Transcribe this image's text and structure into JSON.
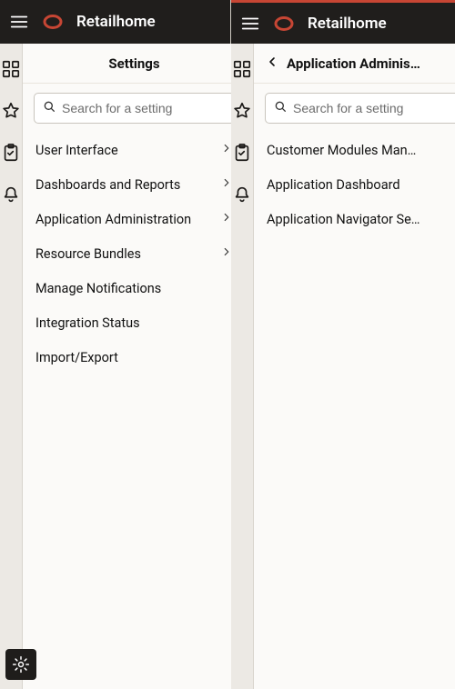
{
  "app_title": "Retailhome",
  "search_placeholder": "Search for a setting",
  "left": {
    "header": "Settings",
    "items": [
      {
        "label": "User Interface",
        "has_children": true
      },
      {
        "label": "Dashboards and Reports",
        "has_children": true
      },
      {
        "label": "Application Administration",
        "has_children": true
      },
      {
        "label": "Resource Bundles",
        "has_children": true
      },
      {
        "label": "Manage Notifications",
        "has_children": false
      },
      {
        "label": "Integration Status",
        "has_children": false
      },
      {
        "label": "Import/Export",
        "has_children": false
      }
    ]
  },
  "right": {
    "header": "Application Administra…",
    "items": [
      {
        "label": "Customer Modules Man…",
        "has_children": false
      },
      {
        "label": "Application Dashboard",
        "has_children": false
      },
      {
        "label": "Application Navigator Se…",
        "has_children": false
      }
    ]
  },
  "rail_icons": [
    "grid-icon",
    "star-icon",
    "clipboard-icon",
    "bell-icon"
  ],
  "colors": {
    "accent": "#c74634",
    "topbar": "#201e1c",
    "bg": "#ece9e4"
  }
}
